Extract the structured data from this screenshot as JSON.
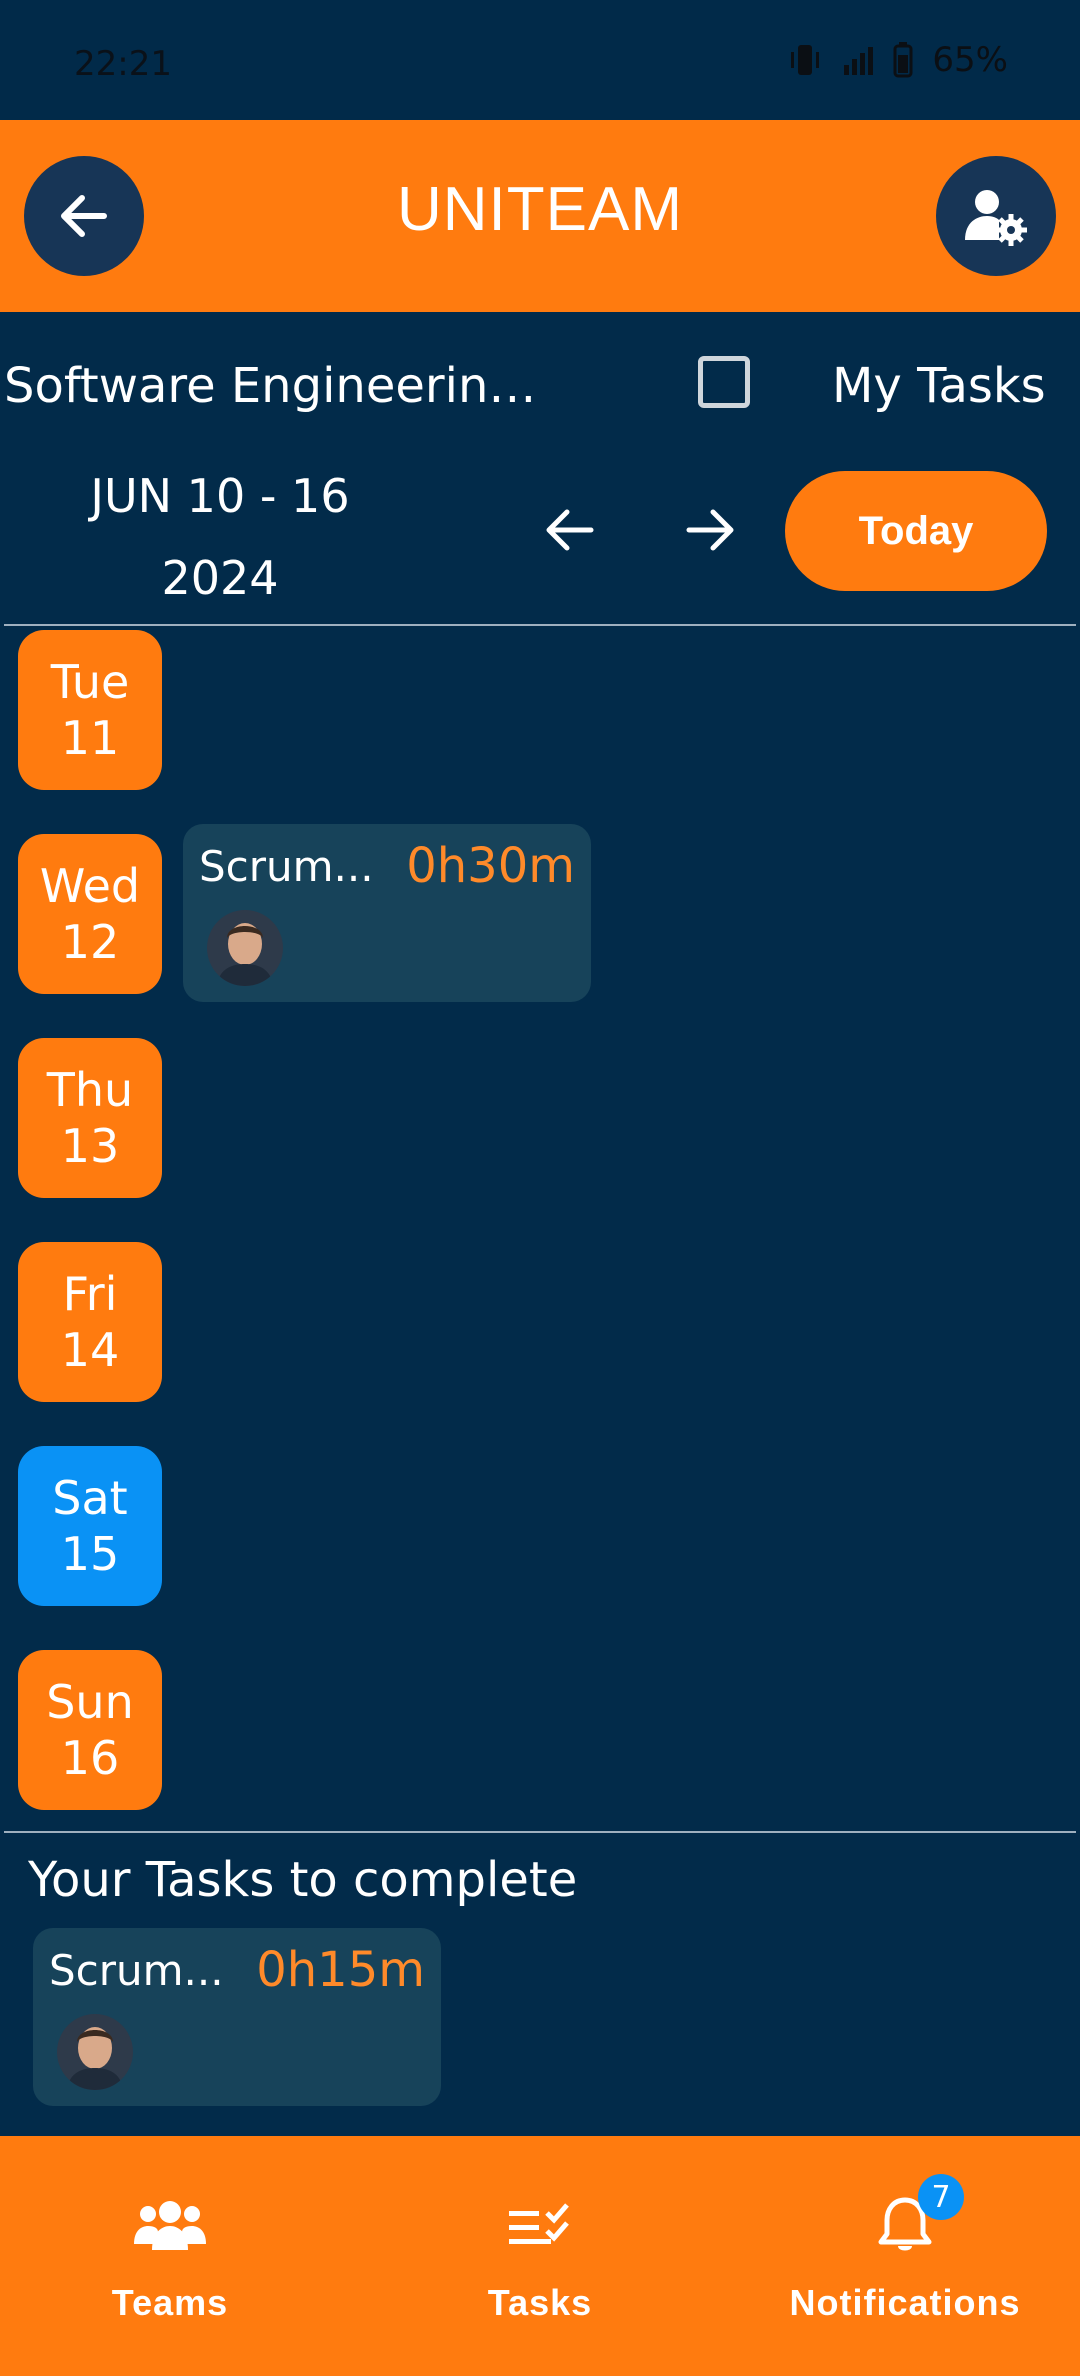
{
  "status_bar": {
    "time": "22:21",
    "battery": "65%"
  },
  "app_bar": {
    "title": "UNITEAM",
    "back_icon": "arrow-left-icon",
    "settings_icon": "user-gear-icon"
  },
  "filter": {
    "team_name": "Software Engineerin…",
    "my_tasks_label": "My Tasks",
    "my_tasks_checked": false
  },
  "week": {
    "range": "JUN 10 - 16",
    "year": "2024",
    "today_label": "Today"
  },
  "days": [
    {
      "weekday": "Tue",
      "day": "11"
    },
    {
      "weekday": "Wed",
      "day": "12"
    },
    {
      "weekday": "Thu",
      "day": "13"
    },
    {
      "weekday": "Fri",
      "day": "14"
    },
    {
      "weekday": "Sat",
      "day": "15",
      "is_today": true
    },
    {
      "weekday": "Sun",
      "day": "16"
    }
  ],
  "scheduled_task": {
    "title": "Scrum...",
    "duration": "0h30m"
  },
  "pending": {
    "heading": "Your Tasks to complete",
    "task": {
      "title": "Scrum...",
      "duration": "0h15m"
    }
  },
  "bottom_nav": {
    "teams": "Teams",
    "tasks": "Tasks",
    "notifications": "Notifications",
    "notifications_count": "7"
  },
  "colors": {
    "accent": "#ff7b0f",
    "background": "#022b4a",
    "today": "#0a92f5",
    "card": "#17435a"
  }
}
